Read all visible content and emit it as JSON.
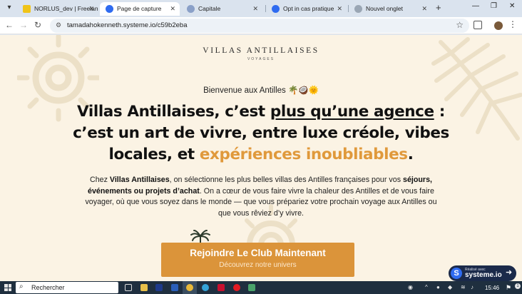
{
  "browser": {
    "tabs": [
      {
        "title": "NORLUS_dev | Freelance",
        "favicon": "freelance-favicon",
        "active": false
      },
      {
        "title": "Page de capture",
        "favicon": "systeme-favicon",
        "active": true
      },
      {
        "title": "Capitale",
        "favicon": "capitale-favicon",
        "active": false
      },
      {
        "title": "Opt in cas pratique",
        "favicon": "systeme-favicon",
        "active": false
      },
      {
        "title": "Nouvel onglet",
        "favicon": "chrome-favicon",
        "active": false
      }
    ],
    "new_tab_icon": "plus-icon",
    "url": "tamadahokenneth.systeme.io/c59b2eba"
  },
  "page": {
    "logo": {
      "title": "VILLAS ANTILLAISES",
      "subtitle": "VOYAGES"
    },
    "welcome": "Bienvenue aux Antilles 🌴🥥🌞",
    "headline": {
      "part1": "Villas Antillaises, c’est ",
      "underlined": "plus qu’une agence",
      "part2": " : c’est un art de vivre, entre luxe créole, vibes locales, et ",
      "accent": "expériences inoubliables",
      "part3": "."
    },
    "paragraph": {
      "t1": "Chez ",
      "b1": "Villas Antillaises",
      "t2": ", on sélectionne les plus belles villas des Antilles françaises pour vos ",
      "b2": "séjours, événements ou projets d’achat",
      "t3": ". On a cœur de vous faire vivre la chaleur des Antilles et de vous faire voyager, où que vous soyez dans le monde — que vous prépariez votre prochain voyage aux Antilles ou que vous rêviez d’y vivre."
    },
    "cta": {
      "title": "Rejoindre Le Club Maintenant",
      "subtitle": "Découvrez notre univers"
    },
    "badge": {
      "top": "Réalisé avec",
      "name": "systeme.io"
    },
    "colors": {
      "background": "#fbf3e4",
      "accent": "#e0993b",
      "button": "#db943a",
      "badge": "#1b2a4a"
    }
  },
  "taskbar": {
    "search_placeholder": "Rechercher",
    "clock": "15:46",
    "notification_count": "1"
  }
}
